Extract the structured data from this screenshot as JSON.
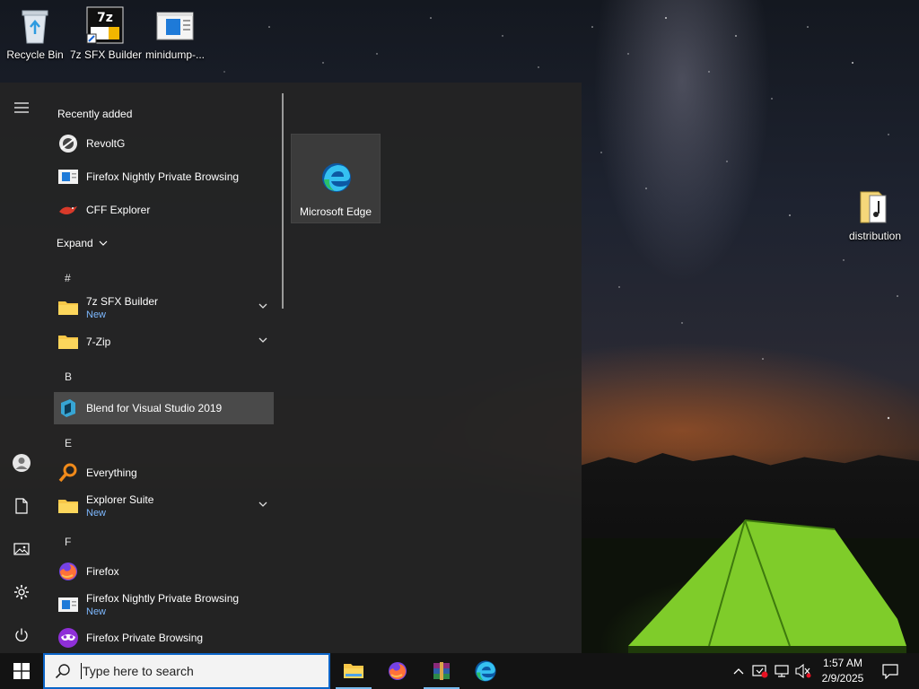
{
  "desktop": {
    "icons": [
      {
        "label": "Recycle Bin",
        "icon": "recycle-bin-icon"
      },
      {
        "label": "7z SFX Builder",
        "icon": "7z-sfx-builder-icon"
      },
      {
        "label": "minidump-...",
        "icon": "minidump-file-icon"
      },
      {
        "label": "distribution",
        "icon": "music-folder-icon"
      }
    ]
  },
  "start_menu": {
    "recently_added_title": "Recently added",
    "recent": [
      {
        "name": "RevoltG",
        "icon": "revoltg-icon"
      },
      {
        "name": "Firefox Nightly Private Browsing",
        "icon": "app-window-icon"
      },
      {
        "name": "CFF Explorer",
        "icon": "cff-explorer-icon"
      }
    ],
    "expand_label": "Expand",
    "groups": [
      {
        "letter": "#",
        "apps": [
          {
            "name": "7z SFX Builder",
            "sub": "New",
            "icon": "folder-icon",
            "has_chevron": true
          },
          {
            "name": "7-Zip",
            "sub": "",
            "icon": "folder-icon",
            "has_chevron": true
          }
        ]
      },
      {
        "letter": "B",
        "apps": [
          {
            "name": "Blend for Visual Studio 2019",
            "sub": "",
            "icon": "blend-icon",
            "highlighted": true
          }
        ]
      },
      {
        "letter": "E",
        "apps": [
          {
            "name": "Everything",
            "sub": "",
            "icon": "everything-search-icon"
          },
          {
            "name": "Explorer Suite",
            "sub": "New",
            "icon": "folder-icon",
            "has_chevron": true
          }
        ]
      },
      {
        "letter": "F",
        "apps": [
          {
            "name": "Firefox",
            "sub": "",
            "icon": "firefox-icon"
          },
          {
            "name": "Firefox Nightly Private Browsing",
            "sub": "New",
            "icon": "app-window-icon"
          },
          {
            "name": "Firefox Private Browsing",
            "sub": "",
            "icon": "firefox-private-icon"
          }
        ]
      }
    ],
    "tiles": [
      {
        "label": "Microsoft Edge",
        "icon": "edge-icon"
      }
    ],
    "rail": [
      "hamburger-menu-icon",
      "user-account-icon",
      "documents-icon",
      "pictures-icon",
      "settings-gear-icon",
      "power-icon"
    ]
  },
  "taskbar": {
    "search_placeholder": "Type here to search",
    "pinned": [
      "file-explorer-icon",
      "firefox-icon",
      "winrar-icon",
      "edge-icon"
    ],
    "tray": [
      "chevron-up-icon",
      "security-alert-icon",
      "network-icon",
      "volume-muted-icon"
    ],
    "clock": {
      "time": "1:57 AM",
      "date": "2/9/2025"
    },
    "notification_icon": "action-center-icon"
  }
}
